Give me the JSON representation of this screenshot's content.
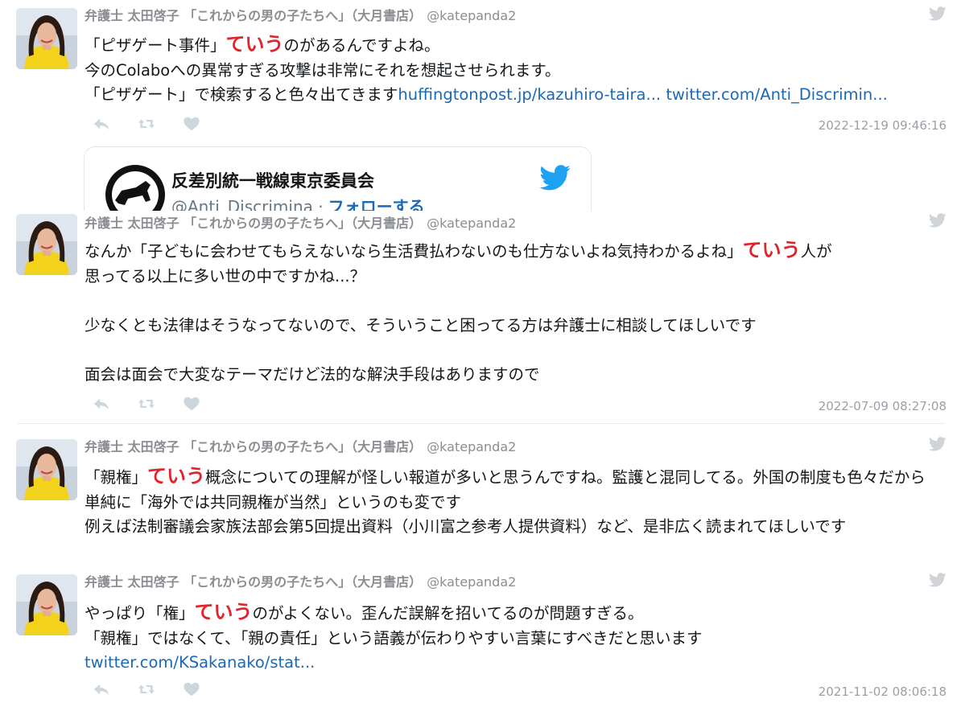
{
  "author": {
    "name": "弁護士 太田啓子 「これからの男の子たちへ」（大月書店）",
    "handle": "@katepanda2"
  },
  "tweets": [
    {
      "lines": [
        {
          "before": "「ピザゲート事件」",
          "kw": "ていう",
          "after": "のがあるんですよね。"
        },
        {
          "text": "今のColaboへの異常すぎる攻撃は非常にそれを想起させられます。"
        },
        {
          "text": "「ピザゲート」で検索すると色々出てきます",
          "link1": "huffingtonpost.jp/kazuhiro-taira...",
          "link2": "twitter.com/Anti_Discrimin..."
        }
      ],
      "timestamp": "2022-12-19 09:46:16",
      "card": {
        "name": "反差別統一戦線東京委員会",
        "handle": "@Anti_Discrimina",
        "sep": "·",
        "follow": "フォローする"
      }
    },
    {
      "lines": [
        {
          "before": "なんか「子どもに会わせてもらえないなら生活費払わないのも仕方ないよね気持わかるよね」",
          "kw": "ていう",
          "after": "人が"
        },
        {
          "text": "思ってる以上に多い世の中ですかね...？"
        },
        {
          "text": "少なくとも法律はそうなってないので、そういうこと困ってる方は弁護士に相談してほしいです"
        },
        {
          "text": "面会は面会で大変なテーマだけど法的な解決手段はありますので"
        }
      ],
      "timestamp": "2022-07-09 08:27:08"
    },
    {
      "lines": [
        {
          "before": "「親権」",
          "kw": "ていう",
          "after": "概念についての理解が怪しい報道が多いと思うんですね。監護と混同してる。外国の制度も色々だから単純に「海外では共同親権が当然」というのも変です"
        },
        {
          "text": "例えば法制審議会家族法部会第5回提出資料（小川富之参考人提供資料）など、是非広く読まれてほしいです"
        }
      ]
    },
    {
      "lines": [
        {
          "before": "やっぱり「権」",
          "kw": "ていう",
          "after": "のがよくない。歪んだ誤解を招いてるのが問題すぎる。"
        },
        {
          "text": "「親権」ではなくて、「親の責任」という語義が伝わりやすい言葉にすべきだと思います"
        },
        {
          "link": "twitter.com/KSakanako/stat..."
        }
      ],
      "timestamp": "2021-11-02 08:06:18"
    }
  ],
  "icons": {
    "reply": "reply-icon",
    "retweet": "retweet-icon",
    "like": "heart-icon",
    "brand": "twitter-bird-icon"
  },
  "colors": {
    "keyword": "#e0242b",
    "link": "#1b69b5",
    "meta": "#8a8d91",
    "action": "#ccd6dd"
  }
}
